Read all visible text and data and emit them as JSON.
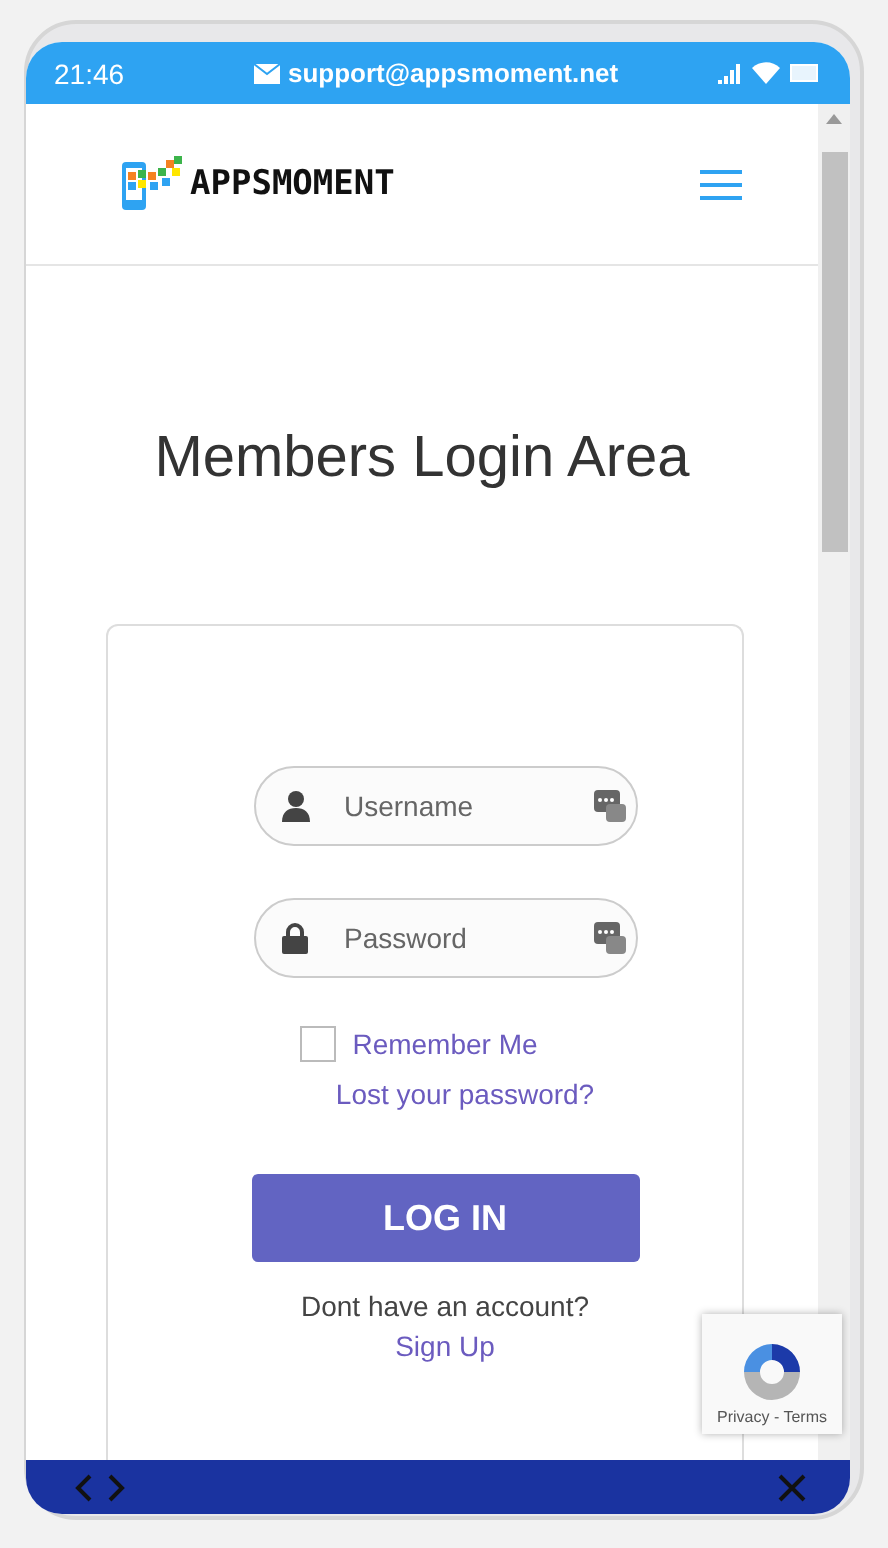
{
  "status_bar": {
    "time": "21:46",
    "email": "support@appsmoment.net"
  },
  "header": {
    "logo_text": "APPSMOMENT"
  },
  "title": "Members Login Area",
  "form": {
    "fields": [
      {
        "kind": "user",
        "placeholder": "Username"
      },
      {
        "kind": "lock",
        "placeholder": "Password"
      }
    ],
    "remember": {
      "label": "Remember Me",
      "checked": false
    },
    "lost_link": "Lost your password?",
    "login_button": "LOG IN",
    "signup_prompt": "Dont have an account?",
    "signup_link": "Sign Up"
  },
  "recaptcha": {
    "links": "Privacy - Terms"
  }
}
